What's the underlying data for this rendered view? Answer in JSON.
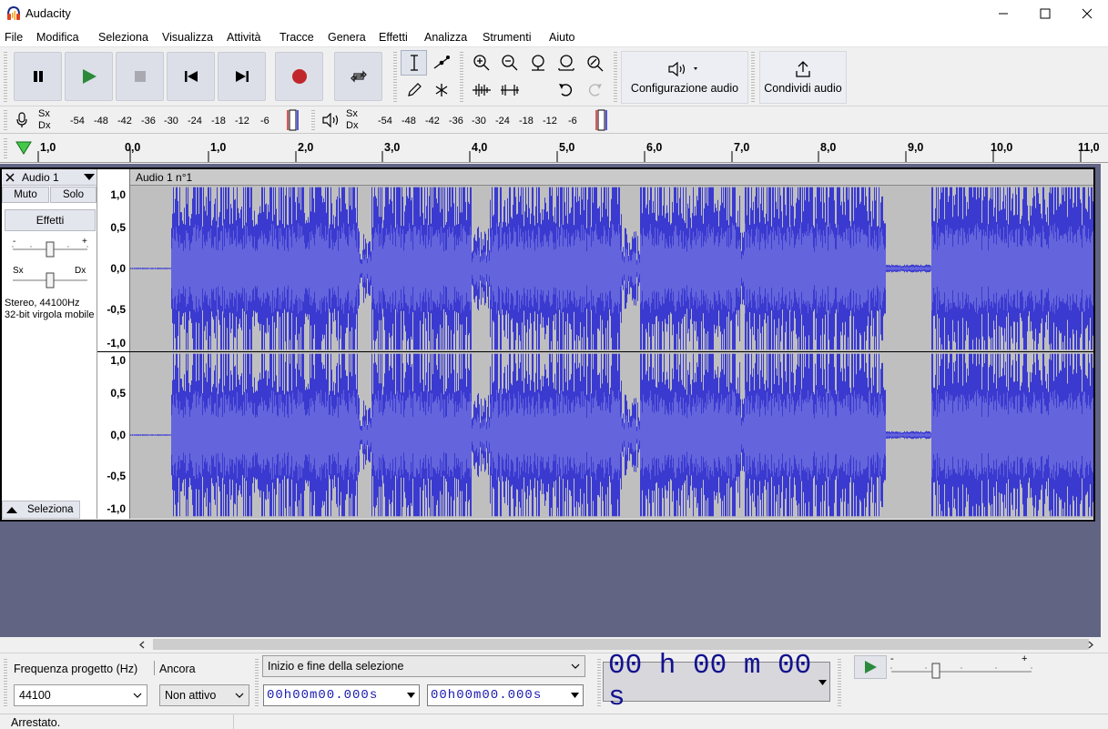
{
  "window": {
    "title": "Audacity",
    "min": "—",
    "max": "☐",
    "close": "✕"
  },
  "menu": [
    "File",
    "Modifica",
    "Seleziona",
    "Visualizza",
    "Attività",
    "Tracce",
    "Genera",
    "Effetti",
    "Analizza",
    "Strumenti",
    "Aiuto"
  ],
  "toolbar": {
    "audio_setup_label": "Configurazione audio",
    "share_label": "Condividi audio"
  },
  "meters": {
    "record_channels": [
      "Sx",
      "Dx"
    ],
    "play_channels": [
      "Sx",
      "Dx"
    ],
    "ticks": [
      "-54",
      "-48",
      "-42",
      "-36",
      "-30",
      "-24",
      "-18",
      "-12",
      "-6"
    ]
  },
  "ruler": {
    "labels": [
      "1,0",
      "0,0",
      "1,0",
      "2,0",
      "3,0",
      "4,0",
      "5,0",
      "6,0",
      "7,0",
      "8,0",
      "9,0",
      "10,0",
      "11,0"
    ]
  },
  "track": {
    "name": "Audio 1",
    "mute": "Muto",
    "solo": "Solo",
    "effects": "Effetti",
    "gain_minus": "-",
    "gain_plus": "+",
    "pan_left": "Sx",
    "pan_right": "Dx",
    "info_line1": "Stereo, 44100Hz",
    "info_line2": "32-bit virgola mobile",
    "select": "Seleziona",
    "clip_name": "Audio 1 n°1",
    "scale_labels": [
      "1,0",
      "0,5",
      "0,0",
      "-0,5",
      "-1,0"
    ]
  },
  "colors": {
    "waveform": "#3a3ad0",
    "waveform_rms": "#6464dc",
    "background_empty": "#626483",
    "clip_bg": "#bfbfbf"
  },
  "selection_toolbar": {
    "rate_label": "Frequenza progetto (Hz)",
    "rate_value": "44100",
    "snap_label": "Ancora",
    "snap_value": "Non attivo",
    "selection_mode": "Inizio e fine della selezione",
    "start_time": "00h00m00.000s",
    "end_time": "00h00m00.000s"
  },
  "time_display": "00 h 00 m 00 s",
  "play_at_speed": {
    "minus": "-",
    "plus": "+"
  },
  "status": "Arrestato."
}
